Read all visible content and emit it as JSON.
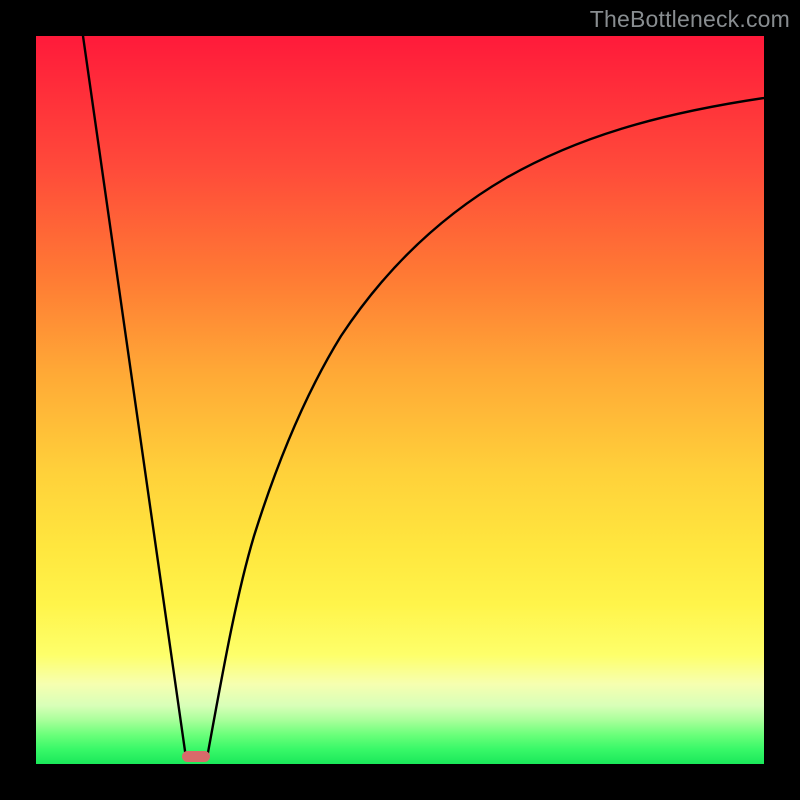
{
  "watermark": "TheBottleneck.com",
  "chart_data": {
    "type": "line",
    "title": "",
    "xlabel": "",
    "ylabel": "",
    "xlim": [
      0,
      100
    ],
    "ylim": [
      0,
      100
    ],
    "grid": false,
    "legend": false,
    "series": [
      {
        "name": "left-descent",
        "x": [
          6.5,
          20.5
        ],
        "values": [
          100,
          1
        ]
      },
      {
        "name": "right-ascent",
        "x": [
          23.5,
          26,
          28,
          30,
          32,
          35,
          38,
          42,
          46,
          50,
          55,
          60,
          66,
          72,
          80,
          88,
          100
        ],
        "values": [
          1,
          8,
          16,
          24,
          31,
          40,
          47,
          55,
          61,
          66,
          71,
          75,
          79,
          82,
          85,
          88,
          91
        ]
      }
    ],
    "marker": {
      "x_start": 20,
      "x_end": 24,
      "y": 0.7
    },
    "background_gradient": {
      "top": "#ff1a3a",
      "mid": "#ffd13a",
      "bottom": "#1ae85a"
    },
    "colors": {
      "curve": "#000000",
      "marker": "#d86a6a",
      "frame": "#000000"
    }
  }
}
